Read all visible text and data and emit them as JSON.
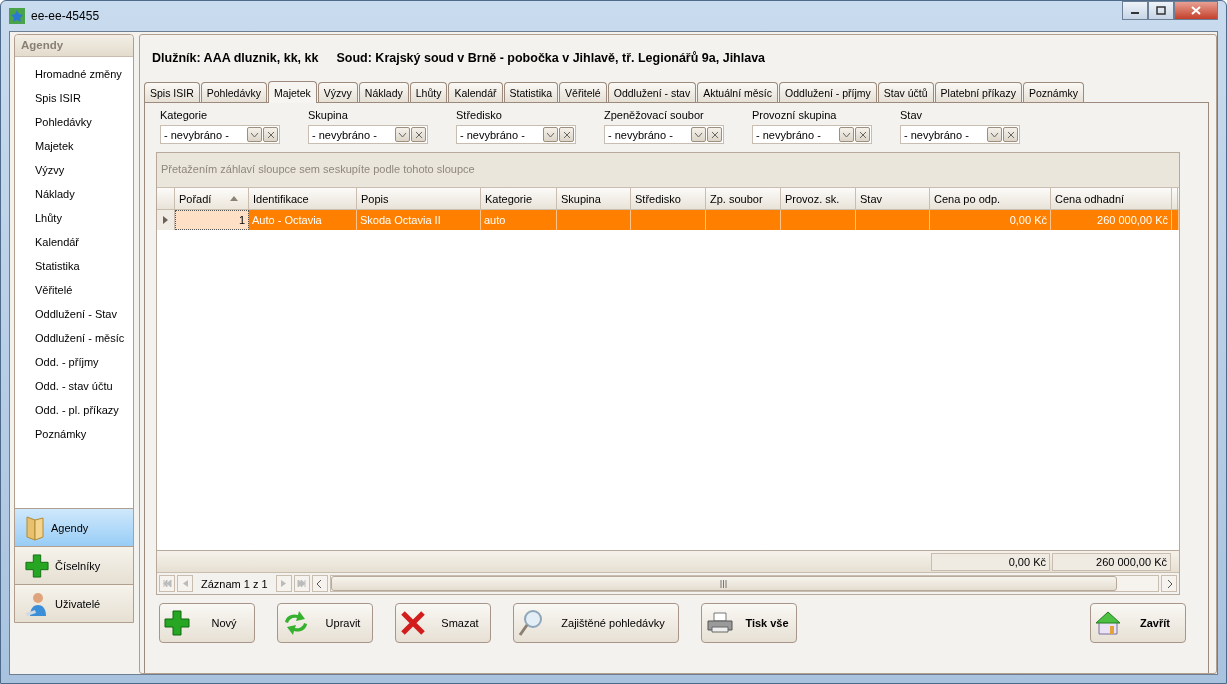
{
  "window": {
    "title": "ee-ee-45455"
  },
  "sidebar": {
    "header": "Agendy",
    "items": [
      {
        "label": "Hromadné změny"
      },
      {
        "label": "Spis ISIR"
      },
      {
        "label": "Pohledávky"
      },
      {
        "label": "Majetek"
      },
      {
        "label": "Výzvy"
      },
      {
        "label": "Náklady"
      },
      {
        "label": "Lhůty"
      },
      {
        "label": "Kalendář"
      },
      {
        "label": "Statistika"
      },
      {
        "label": "Věřitelé"
      },
      {
        "label": "Oddlužení - Stav"
      },
      {
        "label": "Oddlužení - měsíc"
      },
      {
        "label": "Odd. - příjmy"
      },
      {
        "label": "Odd. - stav účtu"
      },
      {
        "label": "Odd. - pl. příkazy"
      },
      {
        "label": "Poznámky"
      }
    ],
    "sections": [
      {
        "label": "Agendy",
        "kind": "folder",
        "selected": true
      },
      {
        "label": "Číselníky",
        "kind": "plus",
        "selected": false
      },
      {
        "label": "Uživatelé",
        "kind": "user",
        "selected": false
      }
    ]
  },
  "header": {
    "debtor": "Dlužník: AAA dluznik, kk, kk",
    "court": "Soud: Krajský soud v Brně - pobočka v Jihlavě, tř. Legionářů 9a, Jihlava"
  },
  "tabs": [
    {
      "label": "Spis ISIR",
      "selected": false
    },
    {
      "label": "Pohledávky",
      "selected": false
    },
    {
      "label": "Majetek",
      "selected": true
    },
    {
      "label": "Výzvy",
      "selected": false
    },
    {
      "label": "Náklady",
      "selected": false
    },
    {
      "label": "Lhůty",
      "selected": false
    },
    {
      "label": "Kalendář",
      "selected": false
    },
    {
      "label": "Statistika",
      "selected": false
    },
    {
      "label": "Věřitelé",
      "selected": false
    },
    {
      "label": "Oddlužení - stav",
      "selected": false
    },
    {
      "label": "Aktuální měsíc",
      "selected": false
    },
    {
      "label": "Oddlužení - příjmy",
      "selected": false
    },
    {
      "label": "Stav účtů",
      "selected": false
    },
    {
      "label": "Platební příkazy",
      "selected": false
    },
    {
      "label": "Poznámky",
      "selected": false
    }
  ],
  "filters": [
    {
      "label": "Kategorie",
      "value": "- nevybráno -"
    },
    {
      "label": "Skupina",
      "value": "- nevybráno -"
    },
    {
      "label": "Středisko",
      "value": "- nevybráno -"
    },
    {
      "label": "Zpeněžovací soubor",
      "value": "- nevybráno -"
    },
    {
      "label": "Provozní skupina",
      "value": "- nevybráno -"
    },
    {
      "label": "Stav",
      "value": "- nevybráno -"
    }
  ],
  "grid": {
    "group_hint": "Přetažením záhlaví sloupce sem seskupíte podle tohoto sloupce",
    "columns": [
      {
        "label": "Pořadí",
        "kind": "number",
        "sorted": true
      },
      {
        "label": "Identifikace",
        "kind": "text",
        "sorted": false
      },
      {
        "label": "Popis",
        "kind": "text",
        "sorted": false
      },
      {
        "label": "Kategorie",
        "kind": "text",
        "sorted": false
      },
      {
        "label": "Skupina",
        "kind": "text",
        "sorted": false
      },
      {
        "label": "Středisko",
        "kind": "text",
        "sorted": false
      },
      {
        "label": "Zp. soubor",
        "kind": "text",
        "sorted": false
      },
      {
        "label": "Provoz. sk.",
        "kind": "text",
        "sorted": false
      },
      {
        "label": "Stav",
        "kind": "text",
        "sorted": false
      },
      {
        "label": "Cena po odp.",
        "kind": "number",
        "sorted": false
      },
      {
        "label": "Cena odhadní",
        "kind": "number",
        "sorted": false
      }
    ],
    "rows": [
      {
        "selected": true,
        "cells": [
          "1",
          "Auto - Octavia",
          "Skoda Octavia II",
          "auto",
          "",
          "",
          "",
          "",
          "",
          "0,00 Kč",
          "260 000,00 Kč"
        ]
      }
    ],
    "totals": [
      "0,00 Kč",
      "260 000,00 Kč"
    ],
    "navigator": "Záznam 1 z 1"
  },
  "buttons": [
    {
      "label": "Nový",
      "kind": "new",
      "bold": false
    },
    {
      "label": "Upravit",
      "kind": "edit",
      "bold": false
    },
    {
      "label": "Smazat",
      "kind": "delete",
      "bold": false
    },
    {
      "label": "Zajištěné pohledávky",
      "kind": "search",
      "bold": false
    },
    {
      "label": "Tisk vše",
      "kind": "print",
      "bold": true
    },
    {
      "label": "Zavřít",
      "kind": "close",
      "bold": true
    }
  ]
}
